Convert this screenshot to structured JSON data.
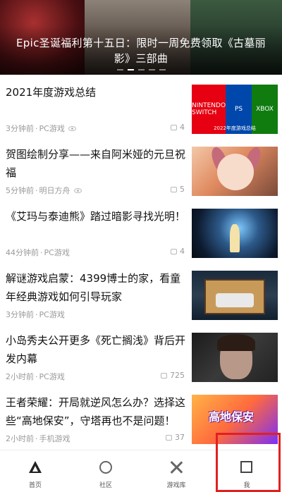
{
  "banner": {
    "title": "Epic圣诞福利第十五日：限时一周免费领取《古墓丽影》三部曲"
  },
  "articles": [
    {
      "title": "2021年度游戏总结",
      "time": "3分钟前",
      "category": "PC游戏",
      "comments": "4",
      "thumb_caption": "2022年度游戏总结",
      "thumb_labels": [
        "NINTENDO SWITCH",
        "PS",
        "XBOX"
      ]
    },
    {
      "title": "贺图绘制分享——来自阿米娅的元旦祝福",
      "time": "5分钟前",
      "category": "明日方舟",
      "comments": "5"
    },
    {
      "title": "《艾玛与泰迪熊》踏过暗影寻找光明！",
      "time": "44分钟前",
      "category": "PC游戏",
      "comments": "4"
    },
    {
      "title": "解谜游戏启蒙：4399博士的家，看童年经典游戏如何引导玩家",
      "time": "3分钟前",
      "category": "PC游戏",
      "comments": ""
    },
    {
      "title": "小岛秀夫公开更多《死亡搁浅》背后开发内幕",
      "time": "2小时前",
      "category": "PC游戏",
      "comments": "725"
    },
    {
      "title": "王者荣耀：开局就逆风怎么办？选择这些“高地保安”，守塔再也不是问题！",
      "time": "2小时前",
      "category": "手机游戏",
      "comments": "37",
      "thumb_text": "高地保安"
    }
  ],
  "nav": [
    {
      "label": "首页",
      "icon": "home-icon"
    },
    {
      "label": "社区",
      "icon": "community-icon"
    },
    {
      "label": "游戏库",
      "icon": "game-library-icon"
    },
    {
      "label": "我",
      "icon": "profile-icon"
    }
  ]
}
